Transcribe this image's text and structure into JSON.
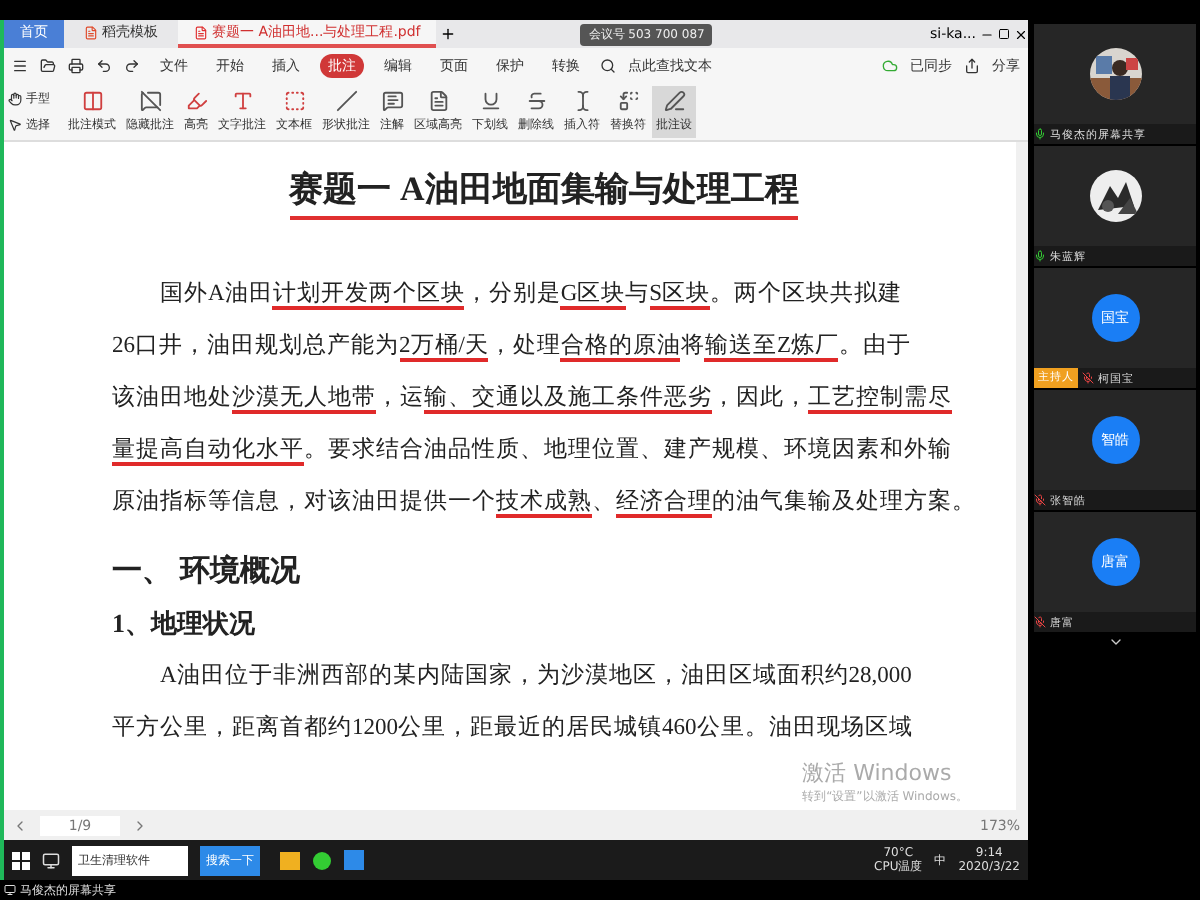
{
  "tabs": [
    {
      "label": "首页",
      "selected": false,
      "kind": "home"
    },
    {
      "label": "稻壳模板",
      "selected": false,
      "kind": "template"
    },
    {
      "label": "赛题一 A油田地...与处理工程.pdf",
      "selected": true,
      "kind": "pdf"
    }
  ],
  "meeting_id": "会议号 503 700 087",
  "user": "si-ka...",
  "menu": [
    {
      "label": "文件",
      "selected": false
    },
    {
      "label": "开始",
      "selected": false
    },
    {
      "label": "插入",
      "selected": false
    },
    {
      "label": "批注",
      "selected": true
    },
    {
      "label": "编辑",
      "selected": false
    },
    {
      "label": "页面",
      "selected": false
    },
    {
      "label": "保护",
      "selected": false
    },
    {
      "label": "转换",
      "selected": false
    }
  ],
  "search": {
    "placeholder": "点此查找文本"
  },
  "sync": "已同步",
  "share": "分享",
  "tools_small": [
    "手型",
    "选择"
  ],
  "tools": [
    {
      "label": "批注模式",
      "selected": false
    },
    {
      "label": "隐藏批注",
      "selected": false
    },
    {
      "label": "高亮",
      "selected": false
    },
    {
      "label": "文字批注",
      "selected": false
    },
    {
      "label": "文本框",
      "selected": false
    },
    {
      "label": "形状批注",
      "selected": false
    },
    {
      "label": "注解",
      "selected": false
    },
    {
      "label": "区域高亮",
      "selected": false
    },
    {
      "label": "下划线",
      "selected": false
    },
    {
      "label": "删除线",
      "selected": false
    },
    {
      "label": "插入符",
      "selected": false
    },
    {
      "label": "替换符",
      "selected": false
    },
    {
      "label": "批注设",
      "selected": true
    }
  ],
  "document": {
    "title": "赛题一 A油田地面集输与处理工程",
    "paragraph_1": [
      [
        {
          "text": "国外A油田",
          "underlined": false
        },
        {
          "text": "计划开发",
          "underlined": true
        },
        {
          "text": "两个区块",
          "underlined": true
        },
        {
          "text": "，分别是",
          "underlined": false
        },
        {
          "text": "G区块",
          "underlined": true
        },
        {
          "text": "与",
          "underlined": false
        },
        {
          "text": "S区块",
          "underlined": true
        },
        {
          "text": "。两个区块共拟建",
          "underlined": false
        }
      ],
      [
        {
          "text": "26口井，油田规划总产能为",
          "underlined": false
        },
        {
          "text": "2万桶/天",
          "underlined": true
        },
        {
          "text": "，处理",
          "underlined": false
        },
        {
          "text": "合格的原油",
          "underlined": true
        },
        {
          "text": "将",
          "underlined": false
        },
        {
          "text": "输送至Z炼厂",
          "underlined": true
        },
        {
          "text": "。由于",
          "underlined": false
        }
      ],
      [
        {
          "text": "该油田地处",
          "underlined": false
        },
        {
          "text": "沙漠无人地带",
          "underlined": true
        },
        {
          "text": "，运",
          "underlined": false
        },
        {
          "text": "输、交通以及施工条件恶劣",
          "underlined": true
        },
        {
          "text": "，因此，",
          "underlined": false
        },
        {
          "text": "工艺控制需尽",
          "underlined": true
        }
      ],
      [
        {
          "text": "量提高自动化水平",
          "underlined": true
        },
        {
          "text": "。要求结合油品性质、地理位置、建产规模、环境因素和外输",
          "underlined": false
        }
      ],
      [
        {
          "text": "原油指标等信息，对该油田提供一个",
          "underlined": false
        },
        {
          "text": "技术成熟",
          "underlined": true
        },
        {
          "text": "、",
          "underlined": false
        },
        {
          "text": "经济合理",
          "underlined": true
        },
        {
          "text": "的油气集输及处理方案。",
          "underlined": false
        }
      ]
    ],
    "heading": "一、 环境概况",
    "subheading": "1、地理状况",
    "paragraph_2": [
      "A油田位于非洲西部的某内陆国家，为沙漠地区，油田区域面积约28,000",
      "平方公里，距离首都约1200公里，距最近的居民城镇460公里。油田现场区域"
    ]
  },
  "activation": {
    "title": "激活 Windows",
    "text": "转到“设置”以激活 Windows。"
  },
  "status": {
    "page": "1/9",
    "zoom": "173%"
  },
  "taskbar": {
    "search_value": "卫生清理软件",
    "search_button": "搜索一下",
    "temperature": "70°C",
    "temperature_label": "CPU温度",
    "ime": "中",
    "time": "9:14",
    "date": "2020/3/22"
  },
  "share_label": "马俊杰的屏幕共享",
  "participants": [
    {
      "name": "马俊杰的屏幕共享",
      "muted": false,
      "host": false
    },
    {
      "name": "朱蓝辉",
      "muted": false,
      "host": false
    },
    {
      "name": "柯国宝",
      "avatar": "国宝",
      "kind": "initials",
      "muted": true,
      "host": true
    },
    {
      "name": "张智皓",
      "avatar": "智皓",
      "kind": "initials",
      "muted": true,
      "host": false
    },
    {
      "name": "唐富",
      "avatar": "唐富",
      "kind": "initials",
      "muted": true,
      "host": false
    }
  ],
  "host_badge": "主持人"
}
